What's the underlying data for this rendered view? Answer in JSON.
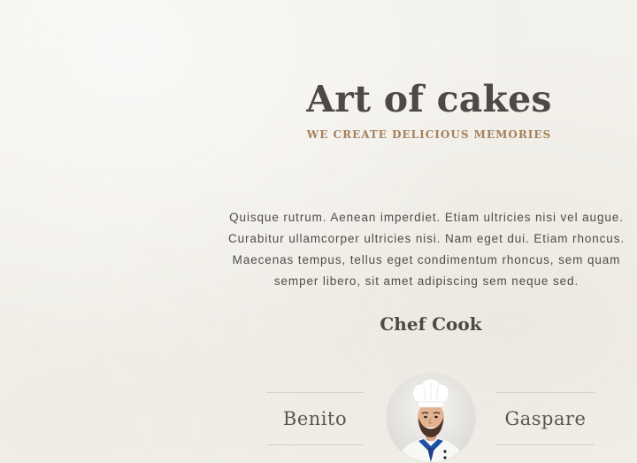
{
  "header": {
    "title": "Art of cakes",
    "subtitle": "WE CREATE DELICIOUS MEMORIES"
  },
  "intro": {
    "lines": [
      "Quisque rutrum. Aenean imperdiet. Etiam ultricies nisi vel augue.",
      "Curabitur ullamcorper ultricies nisi. Nam eget dui. Etiam rhoncus.",
      "Maecenas tempus, tellus eget condimentum rhoncus, sem quam",
      "semper libero, sit amet adipiscing sem neque sed."
    ]
  },
  "chefs": {
    "heading": "Chef Cook",
    "left_name": "Benito",
    "right_name": "Gaspare",
    "avatar_icon": "chef-portrait"
  },
  "colors": {
    "heading": "#4d4a45",
    "accent": "#a4815c",
    "background": "#f3f1ec"
  }
}
